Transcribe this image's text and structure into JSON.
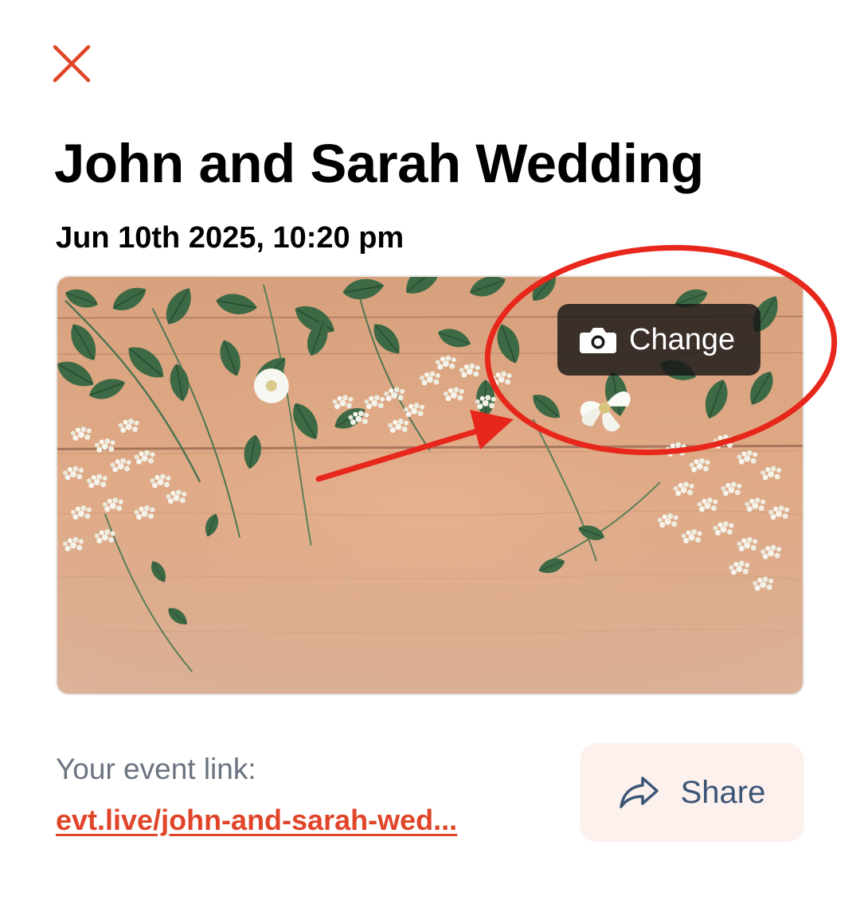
{
  "header": {
    "close_icon": "close-icon",
    "close_color": "#e0452a"
  },
  "event": {
    "title": "John and Sarah Wedding",
    "date": "Jun 10th 2025, 10:20 pm"
  },
  "cover": {
    "change_label": "Change",
    "change_icon": "camera-icon",
    "annotation_color": "#e8271c"
  },
  "link": {
    "label": "Your event link:",
    "url_text": "evt.live/john-and-sarah-wed...",
    "color": "#e0452a"
  },
  "share": {
    "label": "Share",
    "icon": "share-icon",
    "bg": "#fdf1ee",
    "text_color": "#3c5575"
  }
}
